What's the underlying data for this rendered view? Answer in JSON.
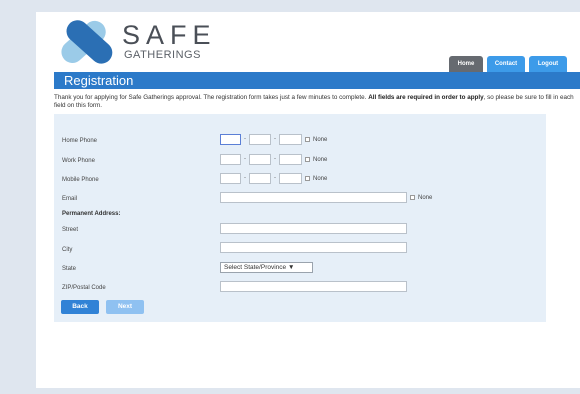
{
  "brand": {
    "name": "SAFE",
    "tagline": "GATHERINGS",
    "colors": {
      "primary": "#2c7ac9",
      "accent": "#3d9be9",
      "logo_light": "#9bcbe8",
      "logo_dark": "#2b6fb4"
    }
  },
  "nav": {
    "home": "Home",
    "contact": "Contact",
    "logout": "Logout"
  },
  "page": {
    "title": "Registration",
    "intro_normal": "Thank you for applying for Safe Gatherings approval. The registration form takes just a few minutes to complete. ",
    "intro_bold": "All fields are required in order to apply",
    "intro_tail": ", so please be sure to fill in each field on this form."
  },
  "form": {
    "home_phone": {
      "label": "Home Phone",
      "area": "",
      "prefix": "",
      "line": "",
      "none_label": "None"
    },
    "work_phone": {
      "label": "Work Phone",
      "area": "",
      "prefix": "",
      "line": "",
      "none_label": "None"
    },
    "mobile_phone": {
      "label": "Mobile Phone",
      "area": "",
      "prefix": "",
      "line": "",
      "none_label": "None"
    },
    "email": {
      "label": "Email",
      "value": "",
      "none_label": "None"
    },
    "permanent_address": {
      "label": "Permanent Address:"
    },
    "street": {
      "label": "Street",
      "value": ""
    },
    "city": {
      "label": "City",
      "value": ""
    },
    "state": {
      "label": "State",
      "selected": "Select State/Province ▼"
    },
    "zip": {
      "label": "ZIP/Postal Code",
      "value": ""
    },
    "separator": "-"
  },
  "buttons": {
    "back": "Back",
    "next": "Next"
  }
}
